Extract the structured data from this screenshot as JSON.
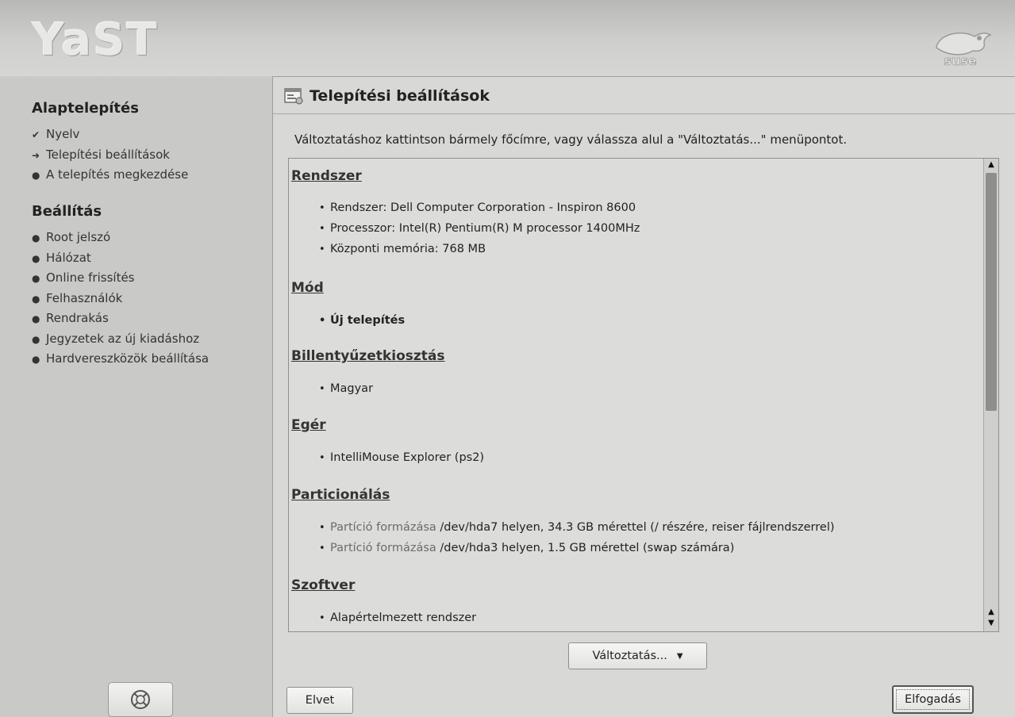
{
  "header": {
    "logo_text": "YaST",
    "brand_logo": "suse-logo"
  },
  "sidebar": {
    "sections": [
      {
        "heading": "Alaptelepítés",
        "items": [
          {
            "label": "Nyelv",
            "marker": "check-icon"
          },
          {
            "label": "Telepítési beállítások",
            "marker": "arrow-right-icon"
          },
          {
            "label": "A telepítés megkezdése",
            "marker": "bullet-icon"
          }
        ]
      },
      {
        "heading": "Beállítás",
        "items": [
          {
            "label": "Root jelszó",
            "marker": "bullet-icon"
          },
          {
            "label": "Hálózat",
            "marker": "bullet-icon"
          },
          {
            "label": "Online frissítés",
            "marker": "bullet-icon"
          },
          {
            "label": "Felhasználók",
            "marker": "bullet-icon"
          },
          {
            "label": "Rendrakás",
            "marker": "bullet-icon"
          },
          {
            "label": "Jegyzetek az új kiadáshoz",
            "marker": "bullet-icon"
          },
          {
            "label": "Hardvereszközök beállítása",
            "marker": "bullet-icon"
          }
        ]
      }
    ],
    "help_icon": "help-lifebuoy-icon"
  },
  "main": {
    "title": "Telepítési beállítások",
    "title_icon": "settings-window-icon",
    "instruction": "Változtatáshoz kattintson bármely főcímre, vagy válassza alul a \"Változtatás...\" menüpontot.",
    "summary": [
      {
        "title": "Rendszer",
        "items": [
          "Rendszer: Dell Computer Corporation - Inspiron 8600",
          "Processzor: Intel(R) Pentium(R) M processor 1400MHz",
          "Központi memória: 768 MB"
        ]
      },
      {
        "title": "Mód",
        "items": [
          "Új telepítés"
        ]
      },
      {
        "title": "Billentyűzetkiosztás",
        "items": [
          "Magyar"
        ]
      },
      {
        "title": "Egér",
        "items": [
          "IntelliMouse Explorer (ps2)"
        ]
      },
      {
        "title": "Particionálás",
        "items": [
          {
            "link": "Partíció formázása",
            "rest": " /dev/hda7 helyen, 34.3 GB mérettel (/ részére, reiser fájlrendszerrel)"
          },
          {
            "link": "Partíció formázása",
            "rest": " /dev/hda3 helyen, 1.5 GB mérettel (swap számára)"
          }
        ]
      },
      {
        "title": "Szoftver",
        "items": [
          "Alapértelmezett rendszer"
        ]
      }
    ],
    "change_button": "Változtatás...",
    "discard_button": "Elvet",
    "accept_button": "Elfogadás"
  }
}
